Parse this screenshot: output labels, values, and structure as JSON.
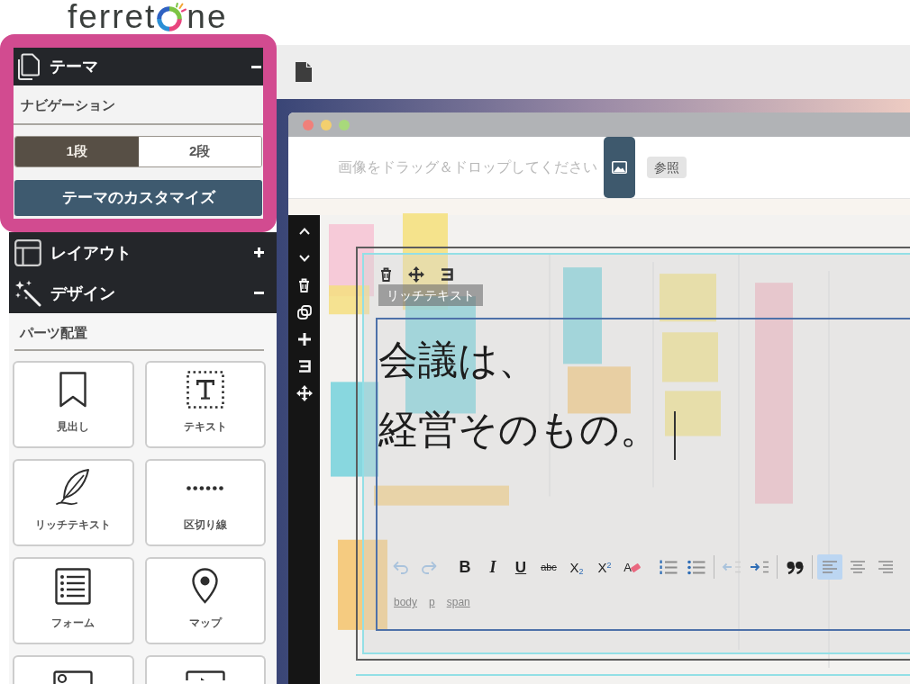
{
  "logo": {
    "lead": "ferret",
    "tail": "ne"
  },
  "sidebar": {
    "sections": [
      {
        "kind": "theme",
        "title": "テーマ",
        "expanded": true,
        "highlighted": true,
        "subheading": "ナビゲーション",
        "segments": [
          {
            "label": "1段",
            "selected": true
          },
          {
            "label": "2段",
            "selected": false
          }
        ],
        "button": "テーマのカスタマイズ"
      },
      {
        "kind": "layout",
        "title": "レイアウト",
        "expanded": false,
        "highlighted": false
      },
      {
        "kind": "design",
        "title": "デザイン",
        "expanded": true,
        "highlighted": false,
        "subheading": "パーツ配置",
        "parts": [
          {
            "kind": "heading",
            "label": "見出し"
          },
          {
            "kind": "text",
            "label": "テキスト"
          },
          {
            "kind": "rich_text",
            "label": "リッチテキスト"
          },
          {
            "kind": "divider",
            "label": "区切り線"
          },
          {
            "kind": "form",
            "label": "フォーム"
          },
          {
            "kind": "map",
            "label": "マップ"
          },
          {
            "kind": "image"
          },
          {
            "kind": "video"
          }
        ]
      }
    ]
  },
  "editor": {
    "drop_hint": "画像をドラッグ＆ドロップしてください",
    "browse_button": "参照",
    "block": {
      "label": "リッチテキスト",
      "lines": [
        "会議は、",
        "経営そのもの。"
      ],
      "toolbar_groups": [
        {
          "separated": false,
          "buttons": [
            {
              "kind": "undo",
              "disabled": true
            },
            {
              "kind": "redo",
              "disabled": true
            }
          ]
        },
        {
          "separated": false,
          "buttons": [
            {
              "kind": "bold",
              "label": "B",
              "disabled": false
            },
            {
              "kind": "italic",
              "label": "I",
              "disabled": false
            },
            {
              "kind": "underline",
              "label": "U",
              "disabled": false
            },
            {
              "kind": "strike",
              "label": "abc",
              "disabled": false
            },
            {
              "kind": "subscript",
              "label": "X$_{2}$",
              "disabled": false
            },
            {
              "kind": "superscript",
              "label": "X$^{2}$",
              "disabled": false
            },
            {
              "kind": "clear_format",
              "label": "A",
              "disabled": false
            }
          ]
        },
        {
          "separated": false,
          "buttons": [
            {
              "kind": "ordered_list",
              "disabled": false
            },
            {
              "kind": "bullet_list",
              "disabled": false
            }
          ]
        },
        {
          "separated": true,
          "buttons": [
            {
              "kind": "outdent",
              "disabled": true
            },
            {
              "kind": "indent",
              "disabled": false
            }
          ]
        },
        {
          "separated": true,
          "buttons": [
            {
              "kind": "quote",
              "disabled": false
            }
          ]
        },
        {
          "separated": true,
          "buttons": [
            {
              "kind": "align_left",
              "disabled": false,
              "selected": true
            },
            {
              "kind": "align_center",
              "disabled": false,
              "selected": false
            },
            {
              "kind": "align_right",
              "disabled": false,
              "selected": false
            }
          ]
        }
      ],
      "path": [
        "body",
        "p",
        "span"
      ]
    }
  }
}
